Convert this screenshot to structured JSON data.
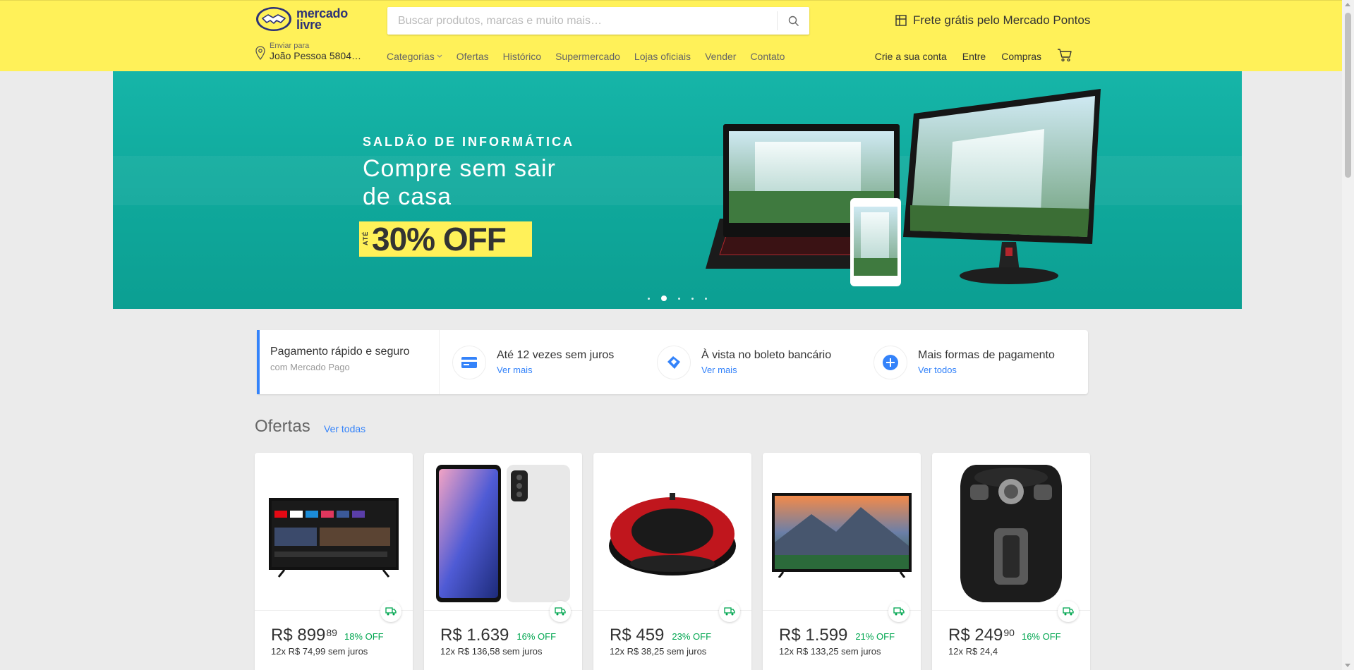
{
  "header": {
    "logo_line1": "mercado",
    "logo_line2": "livre",
    "search_placeholder": "Buscar produtos, marcas e muito mais…",
    "promo": "Frete grátis pelo Mercado Pontos",
    "location_label": "Enviar para",
    "location_city": "João Pessoa 5804…",
    "nav": [
      "Categorias",
      "Ofertas",
      "Histórico",
      "Supermercado",
      "Lojas oficiais",
      "Vender",
      "Contato"
    ],
    "user_nav": [
      "Crie a sua conta",
      "Entre",
      "Compras"
    ],
    "brand_color": "#fff159"
  },
  "banner": {
    "kicker": "SALDÃO DE INFORMÁTICA",
    "title": "Compre sem sair de casa",
    "ate": "ATÉ",
    "off": "30% OFF",
    "slides": 5,
    "active_slide": 2
  },
  "payment": {
    "first_title": "Pagamento rápido e seguro",
    "first_sub": "com Mercado Pago",
    "items": [
      {
        "title": "Até 12 vezes sem juros",
        "link": "Ver mais",
        "icon": "credit-card-icon"
      },
      {
        "title": "À vista no boleto bancário",
        "link": "Ver mais",
        "icon": "boleto-icon"
      },
      {
        "title": "Mais formas de pagamento",
        "link": "Ver todos",
        "icon": "plus-icon"
      }
    ]
  },
  "ofertas": {
    "title": "Ofertas",
    "link": "Ver todas",
    "products": [
      {
        "price": "R$ 899",
        "cents": "89",
        "off": "18% OFF",
        "inst": "12x R$ 74,99 sem juros",
        "kind": "tv-smart"
      },
      {
        "price": "R$ 1.639",
        "cents": "",
        "off": "16% OFF",
        "inst": "12x R$ 136,58 sem juros",
        "kind": "phone"
      },
      {
        "price": "R$ 459",
        "cents": "",
        "off": "23% OFF",
        "inst": "12x R$ 38,25 sem juros",
        "kind": "robot-vacuum"
      },
      {
        "price": "R$ 1.599",
        "cents": "",
        "off": "21% OFF",
        "inst": "12x R$ 133,25 sem juros",
        "kind": "tv-landscape"
      },
      {
        "price": "R$ 249",
        "cents": "90",
        "off": "16% OFF",
        "inst": "12x R$ 24,4",
        "kind": "air-fryer"
      }
    ]
  }
}
